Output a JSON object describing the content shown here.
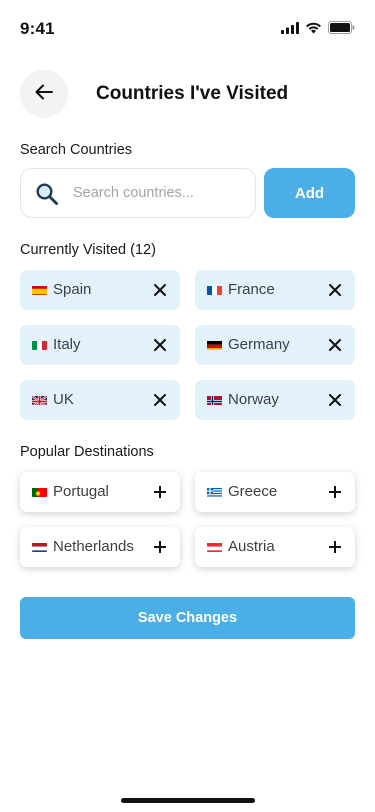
{
  "status_bar": {
    "time": "9:41"
  },
  "header": {
    "title": "Countries I've Visited"
  },
  "search": {
    "label": "Search Countries",
    "placeholder": "Search countries...",
    "value": "",
    "add_label": "Add"
  },
  "visited": {
    "label": "Currently Visited (12)",
    "items": [
      {
        "name": "Spain",
        "flag": "flag-spain-icon"
      },
      {
        "name": "France",
        "flag": "flag-france-icon"
      },
      {
        "name": "Italy",
        "flag": "flag-italy-icon"
      },
      {
        "name": "Germany",
        "flag": "flag-germany-icon"
      },
      {
        "name": "UK",
        "flag": "flag-uk-icon"
      },
      {
        "name": "Norway",
        "flag": "flag-norway-icon"
      }
    ],
    "action_icon": "close-icon"
  },
  "popular": {
    "label": "Popular Destinations",
    "items": [
      {
        "name": "Portugal",
        "flag": "flag-portugal-icon"
      },
      {
        "name": "Greece",
        "flag": "flag-greece-icon"
      },
      {
        "name": "Netherlands",
        "flag": "flag-netherlands-icon"
      },
      {
        "name": "Austria",
        "flag": "flag-austria-icon"
      }
    ],
    "action_icon": "plus-icon"
  },
  "save_label": "Save Changes",
  "colors": {
    "accent": "#4caee6",
    "visited_chip_bg": "#e3f1fb",
    "text": "#111111",
    "muted_text": "#3d3f44",
    "placeholder": "#a0a4ab"
  }
}
